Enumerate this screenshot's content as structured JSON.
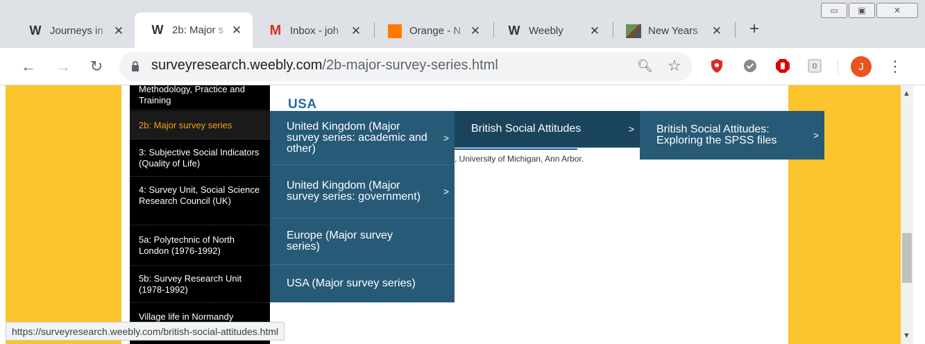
{
  "tabs": [
    {
      "label": "Journeys in",
      "icon": "weebly-icon"
    },
    {
      "label": "2b: Major s",
      "icon": "weebly-icon"
    },
    {
      "label": "Inbox - joh",
      "icon": "gmail-icon"
    },
    {
      "label": "Orange - N",
      "icon": "orange-icon"
    },
    {
      "label": "Weebly",
      "icon": "weebly-icon"
    },
    {
      "label": "New Years",
      "icon": "image-icon"
    }
  ],
  "omnibox": {
    "domain": "surveyresearch.weebly.com",
    "path": "/2b-major-survey-series.html"
  },
  "avatar_letter": "J",
  "sidebar": {
    "items": [
      {
        "label": "Methodology, Practice and Training"
      },
      {
        "label": "2b: Major survey series"
      },
      {
        "label": "3: Subjective Social Indicators (Quality of Life)"
      },
      {
        "label": "4: Survey Unit, Social Science Research Council (UK)"
      },
      {
        "label": "5a: Polytechnic of North London (1976-1992)"
      },
      {
        "label": "5b: Survey Research Unit (1978-1992)"
      },
      {
        "label": "Village life in Normandy"
      }
    ]
  },
  "content": {
    "heading": "USA",
    "body": ", University of Michigan, Ann Arbor."
  },
  "menu1": {
    "items": [
      {
        "label": "United Kingdom (Major survey series: academic and other)",
        "arrow": ">"
      },
      {
        "label": "United Kingdom (Major survey series: government)",
        "arrow": ">"
      },
      {
        "label": "Europe (Major survey series)",
        "arrow": ""
      },
      {
        "label": "USA (Major survey series)",
        "arrow": ""
      }
    ]
  },
  "menu2": {
    "items": [
      {
        "label": "British Social Attitudes",
        "arrow": ">"
      }
    ]
  },
  "menu3": {
    "items": [
      {
        "label": "British Social Attitudes: Exploring the SPSS files",
        "arrow": ">"
      }
    ]
  },
  "status_url": "https://surveyresearch.weebly.com/british-social-attitudes.html",
  "colors": {
    "gutter": "#fbc42d",
    "menu": "#275a77",
    "sidebar_active": "#f7a21b"
  }
}
